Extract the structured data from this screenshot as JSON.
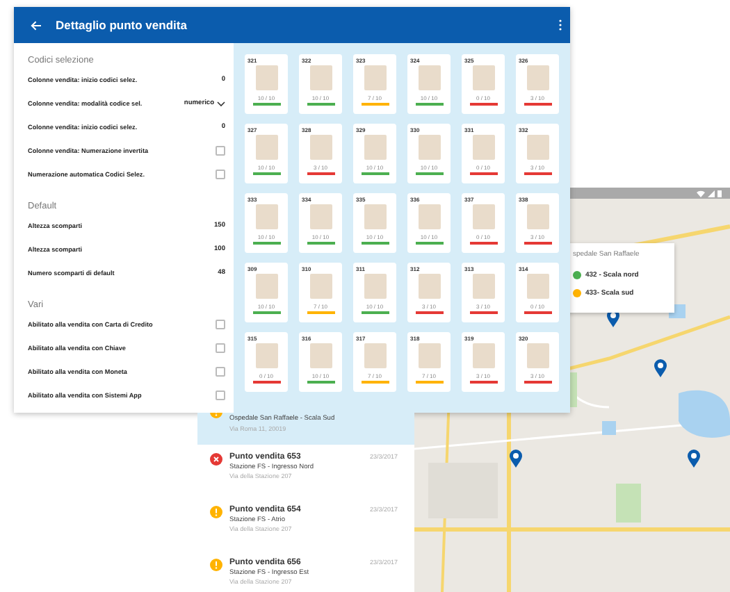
{
  "header": {
    "title": "Dettaglio punto vendita"
  },
  "settings": [
    {
      "heading": "Codici selezione",
      "rows": [
        {
          "kind": "value",
          "label": "Colonne vendita: inizio codici selez.",
          "value": "0"
        },
        {
          "kind": "dropdown",
          "label": "Colonne vendita: modalità codice sel.",
          "value": "numerico"
        },
        {
          "kind": "value",
          "label": "Colonne vendita: inizio codici selez.",
          "value": "0"
        },
        {
          "kind": "checkbox",
          "label": "Colonne vendita: Numerazione invertita",
          "checked": false
        },
        {
          "kind": "checkbox",
          "label": "Numerazione automatica Codici Selez.",
          "checked": false
        }
      ]
    },
    {
      "heading": "Default",
      "rows": [
        {
          "kind": "value",
          "label": "Altezza scomparti",
          "value": "150"
        },
        {
          "kind": "value",
          "label": "Altezza scomparti",
          "value": "100"
        },
        {
          "kind": "value",
          "label": "Numero scomparti di default",
          "value": "48"
        }
      ]
    },
    {
      "heading": "Vari",
      "rows": [
        {
          "kind": "checkbox",
          "label": "Abilitato alla vendita con Carta di Credito",
          "checked": false
        },
        {
          "kind": "checkbox",
          "label": "Abilitato alla vendita con Chiave",
          "checked": false
        },
        {
          "kind": "checkbox",
          "label": "Abilitato alla vendita con Moneta",
          "checked": false
        },
        {
          "kind": "checkbox",
          "label": "Abilitato alla vendita con Sistemi App",
          "checked": false
        }
      ]
    }
  ],
  "tiles": [
    {
      "code": "321",
      "count": "10 / 10",
      "color": "#4caf50"
    },
    {
      "code": "322",
      "count": "10 / 10",
      "color": "#4caf50"
    },
    {
      "code": "323",
      "count": "7 / 10",
      "color": "#ffb300"
    },
    {
      "code": "324",
      "count": "10 / 10",
      "color": "#4caf50"
    },
    {
      "code": "325",
      "count": "0 / 10",
      "color": "#e53935"
    },
    {
      "code": "326",
      "count": "3 / 10",
      "color": "#e53935"
    },
    {
      "code": "327",
      "count": "10 / 10",
      "color": "#4caf50"
    },
    {
      "code": "328",
      "count": "3 / 10",
      "color": "#e53935"
    },
    {
      "code": "329",
      "count": "10 / 10",
      "color": "#4caf50"
    },
    {
      "code": "330",
      "count": "10 / 10",
      "color": "#4caf50"
    },
    {
      "code": "331",
      "count": "0 / 10",
      "color": "#e53935"
    },
    {
      "code": "332",
      "count": "3 / 10",
      "color": "#e53935"
    },
    {
      "code": "333",
      "count": "10 / 10",
      "color": "#4caf50"
    },
    {
      "code": "334",
      "count": "10 / 10",
      "color": "#4caf50"
    },
    {
      "code": "335",
      "count": "10 / 10",
      "color": "#4caf50"
    },
    {
      "code": "336",
      "count": "10 / 10",
      "color": "#4caf50"
    },
    {
      "code": "337",
      "count": "0 / 10",
      "color": "#e53935"
    },
    {
      "code": "338",
      "count": "3 / 10",
      "color": "#e53935"
    },
    {
      "code": "309",
      "count": "10 / 10",
      "color": "#4caf50"
    },
    {
      "code": "310",
      "count": "7 / 10",
      "color": "#ffb300"
    },
    {
      "code": "311",
      "count": "10 / 10",
      "color": "#4caf50"
    },
    {
      "code": "312",
      "count": "3 / 10",
      "color": "#e53935"
    },
    {
      "code": "313",
      "count": "3 / 10",
      "color": "#e53935"
    },
    {
      "code": "314",
      "count": "0 / 10",
      "color": "#e53935"
    },
    {
      "code": "315",
      "count": "0 / 10",
      "color": "#e53935"
    },
    {
      "code": "316",
      "count": "10 / 10",
      "color": "#4caf50"
    },
    {
      "code": "317",
      "count": "7 / 10",
      "color": "#ffb300"
    },
    {
      "code": "318",
      "count": "7 / 10",
      "color": "#ffb300"
    },
    {
      "code": "319",
      "count": "3 / 10",
      "color": "#e53935"
    },
    {
      "code": "320",
      "count": "3 / 10",
      "color": "#e53935"
    }
  ],
  "map": {
    "popup": {
      "title": "spedale San Raffaele",
      "entries": [
        {
          "label": "432 - Scala nord",
          "color": "#4caf50"
        },
        {
          "label": "433- Scala sud",
          "color": "#ffb300"
        }
      ]
    }
  },
  "stores": [
    {
      "kind": "warning",
      "selected": true,
      "subtitle": "Ospedale San Raffaele - Scala Sud",
      "address": "Via Roma 11, 20019"
    },
    {
      "kind": "error",
      "selected": false,
      "title": "Punto vendita 653",
      "date": "23/3/2017",
      "subtitle": "Stazione FS - Ingresso Nord",
      "address": "Via della Stazione 207"
    },
    {
      "kind": "warning",
      "selected": false,
      "title": "Punto vendita 654",
      "date": "23/3/2017",
      "subtitle": "Stazione FS - Atrio",
      "address": "Via della Stazione 207"
    },
    {
      "kind": "warning",
      "selected": false,
      "title": "Punto vendita 656",
      "date": "23/3/2017",
      "subtitle": "Stazione FS - Ingresso Est",
      "address": "Via della Stazione 207"
    }
  ]
}
